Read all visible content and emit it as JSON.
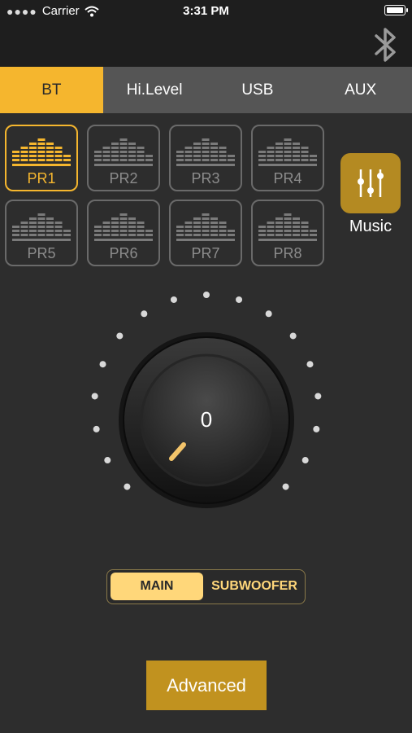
{
  "status_bar": {
    "carrier": "Carrier",
    "time": "3:31 PM",
    "signal_icon": "signal-dots-icon",
    "wifi_icon": "wifi-icon",
    "battery_icon": "battery-icon"
  },
  "header": {
    "bluetooth_icon": "bluetooth-icon"
  },
  "tabs": [
    {
      "label": "BT",
      "active": true
    },
    {
      "label": "Hi.Level",
      "active": false
    },
    {
      "label": "USB",
      "active": false
    },
    {
      "label": "AUX",
      "active": false
    }
  ],
  "presets": [
    {
      "label": "PR1",
      "active": true
    },
    {
      "label": "PR2",
      "active": false
    },
    {
      "label": "PR3",
      "active": false
    },
    {
      "label": "PR4",
      "active": false
    },
    {
      "label": "PR5",
      "active": false
    },
    {
      "label": "PR6",
      "active": false
    },
    {
      "label": "PR7",
      "active": false
    },
    {
      "label": "PR8",
      "active": false
    }
  ],
  "music": {
    "label": "Music",
    "icon": "equalizer-sliders-icon"
  },
  "knob": {
    "value": "0"
  },
  "toggle": {
    "main_label": "MAIN",
    "sub_label": "SUBWOOFER",
    "selected": "MAIN"
  },
  "advanced_button": {
    "label": "Advanced"
  },
  "colors": {
    "accent": "#f5b62e",
    "background": "#2d2d2d",
    "inactive": "#8c8c8c",
    "button": "#c1921f"
  }
}
